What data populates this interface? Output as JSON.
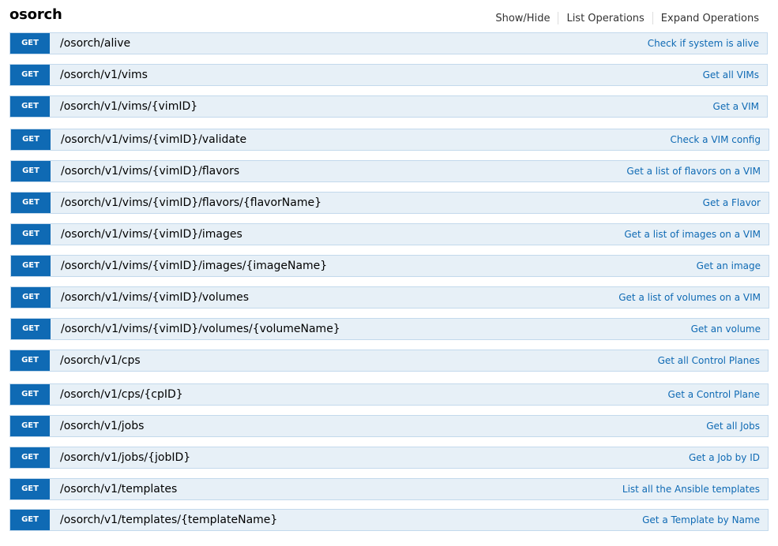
{
  "header": {
    "title": "osorch",
    "links": [
      "Show/Hide",
      "List Operations",
      "Expand Operations"
    ]
  },
  "operations": [
    {
      "method": "GET",
      "path": "/osorch/alive",
      "summary": "Check if system is alive"
    },
    {
      "method": "GET",
      "path": "/osorch/v1/vims",
      "summary": "Get all VIMs"
    },
    {
      "method": "GET",
      "path": "/osorch/v1/vims/{vimID}",
      "summary": "Get a VIM"
    },
    {
      "method": "GET",
      "path": "/osorch/v1/vims/{vimID}/validate",
      "summary": "Check a VIM config"
    },
    {
      "method": "GET",
      "path": "/osorch/v1/vims/{vimID}/flavors",
      "summary": "Get a list of flavors on a VIM"
    },
    {
      "method": "GET",
      "path": "/osorch/v1/vims/{vimID}/flavors/{flavorName}",
      "summary": "Get a Flavor"
    },
    {
      "method": "GET",
      "path": "/osorch/v1/vims/{vimID}/images",
      "summary": "Get a list of images on a VIM"
    },
    {
      "method": "GET",
      "path": "/osorch/v1/vims/{vimID}/images/{imageName}",
      "summary": "Get an image"
    },
    {
      "method": "GET",
      "path": "/osorch/v1/vims/{vimID}/volumes",
      "summary": "Get a list of volumes on a VIM"
    },
    {
      "method": "GET",
      "path": "/osorch/v1/vims/{vimID}/volumes/{volumeName}",
      "summary": "Get an volume"
    },
    {
      "method": "GET",
      "path": "/osorch/v1/cps",
      "summary": "Get all Control Planes"
    },
    {
      "method": "GET",
      "path": "/osorch/v1/cps/{cpID}",
      "summary": "Get a Control Plane"
    },
    {
      "method": "GET",
      "path": "/osorch/v1/jobs",
      "summary": "Get all Jobs"
    },
    {
      "method": "GET",
      "path": "/osorch/v1/jobs/{jobID}",
      "summary": "Get a Job by ID"
    },
    {
      "method": "GET",
      "path": "/osorch/v1/templates",
      "summary": "List all the Ansible templates"
    },
    {
      "method": "GET",
      "path": "/osorch/v1/templates/{templateName}",
      "summary": "Get a Template by Name"
    }
  ]
}
